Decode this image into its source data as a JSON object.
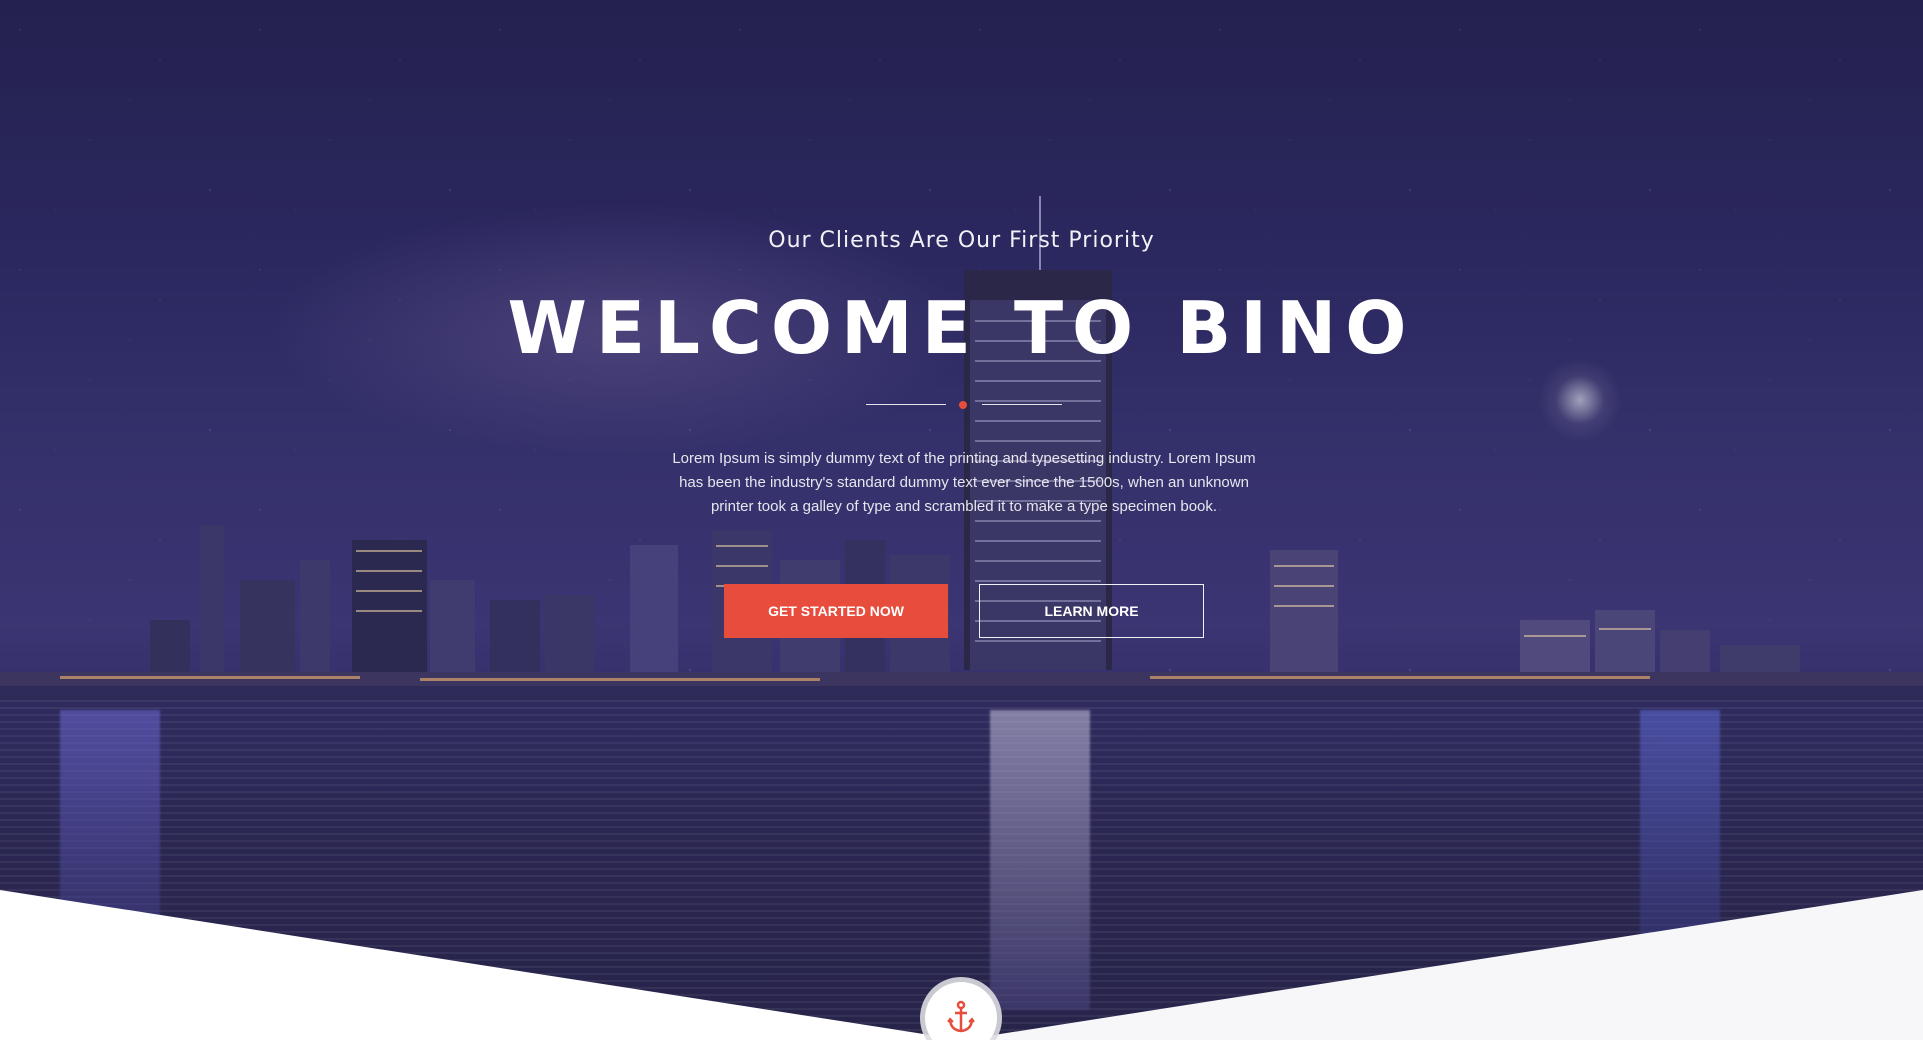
{
  "hero": {
    "tagline": "Our Clients Are Our First Priority",
    "title": "WELCOME TO BINO",
    "description": "Lorem Ipsum is simply dummy text of the printing and typesetting industry. Lorem Ipsum has been the industry's standard dummy text ever since the 1500s, when an unknown printer took a galley of type and scrambled it to make a type specimen book.",
    "primary_button": "GET STARTED NOW",
    "secondary_button": "LEARN MORE",
    "accent_color": "#e74c3c",
    "scroll_icon": "anchor-icon"
  }
}
